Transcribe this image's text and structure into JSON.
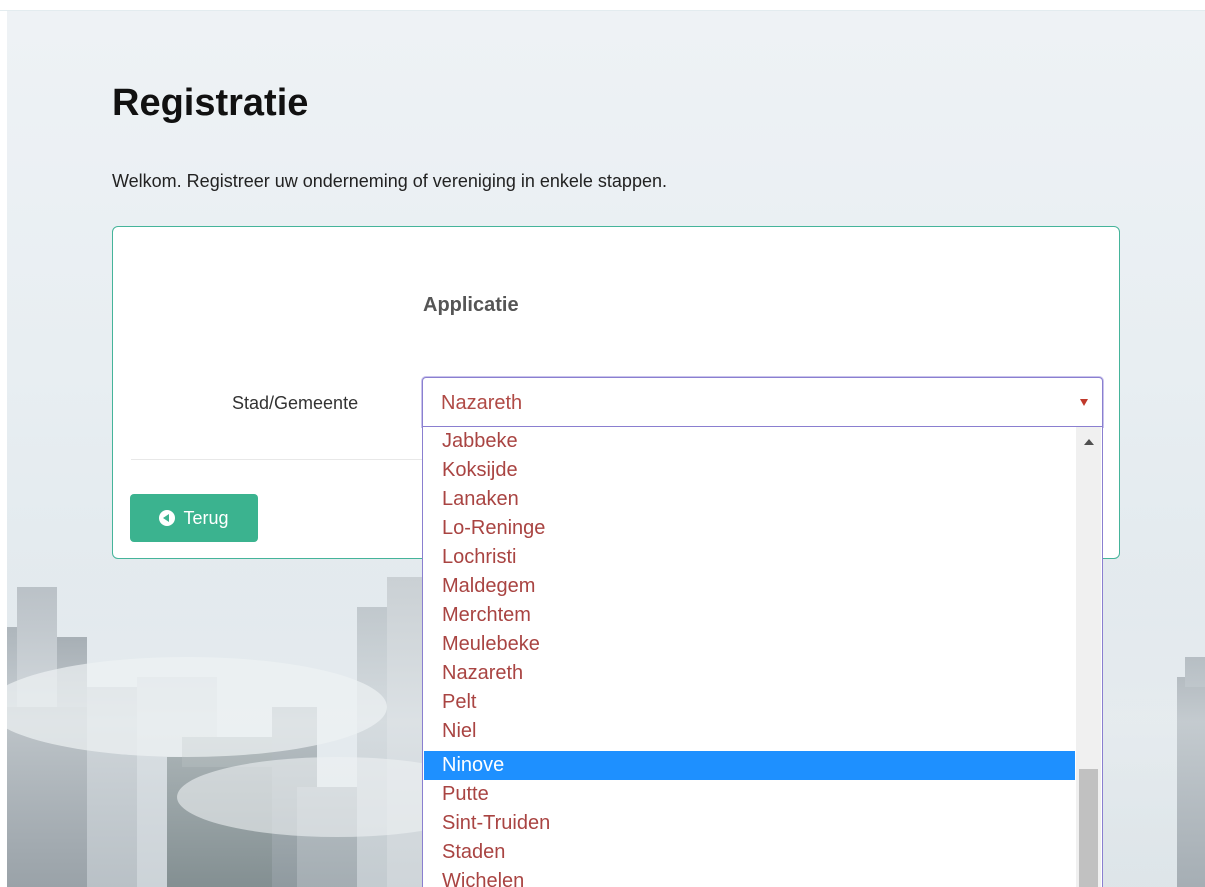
{
  "page": {
    "title": "Registratie",
    "intro": "Welkom. Registreer uw onderneming of vereniging in enkele stappen."
  },
  "panel": {
    "title": "Applicatie",
    "field_label": "Stad/Gemeente",
    "back_button": "Terug"
  },
  "select": {
    "value": "Nazareth",
    "selected_option": "Ninove",
    "options": [
      "Jabbeke",
      "Koksijde",
      "Lanaken",
      "Lo-Reninge",
      "Lochristi",
      "Maldegem",
      "Merchtem",
      "Meulebeke",
      "Nazareth",
      "Pelt",
      "Niel",
      "Ninove",
      "Putte",
      "Sint-Truiden",
      "Staden",
      "Wichelen"
    ]
  },
  "colors": {
    "accent": "#3bb38f",
    "option_text": "#a94442",
    "selected_bg": "#1e90ff"
  }
}
